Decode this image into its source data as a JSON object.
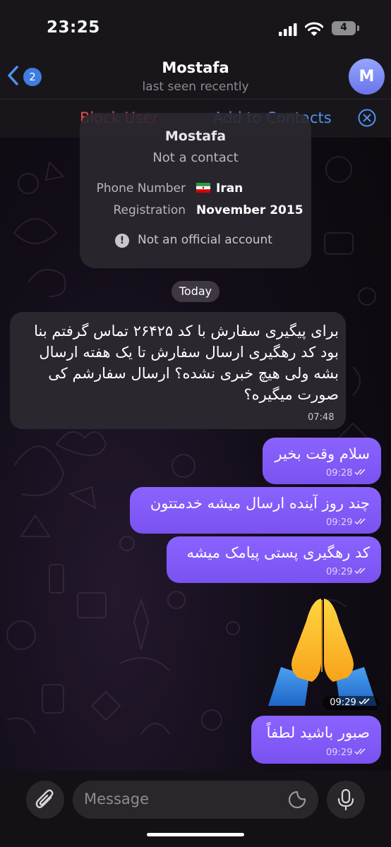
{
  "status_bar": {
    "time": "23:25",
    "battery": "4"
  },
  "header": {
    "back_count": "2",
    "title": "Mostafa",
    "subtitle": "last seen recently",
    "avatar_letter": "M"
  },
  "actions": {
    "block": "Block User",
    "add": "Add to Contacts"
  },
  "contact_card": {
    "name": "Mostafa",
    "status": "Not a contact",
    "phone_label": "Phone Number",
    "phone_value": "Iran",
    "reg_label": "Registration",
    "reg_value": "November 2015",
    "official": "Not an official account"
  },
  "date_divider": "Today",
  "messages": [
    {
      "dir": "in",
      "lines": [
        "برای پیگیری سفارش با کد ۲۶۴۲۵ تماس گرفتم بنا",
        "بود کد رهگیری ارسال سفارش تا یک هفته ارسال",
        "بشه ولی هیچ خبری نشده؟ ارسال سفارشم کی",
        "صورت میگیره؟"
      ],
      "time": "07:48"
    },
    {
      "dir": "out",
      "text": "سلام وقت بخیر",
      "time": "09:28"
    },
    {
      "dir": "out",
      "text": "چند روز آینده ارسال میشه خدمتتون",
      "time": "09:29"
    },
    {
      "dir": "out",
      "text": "کد رهگیری پستی پیامک میشه",
      "time": "09:29"
    },
    {
      "dir": "out",
      "emoji": "folded-hands",
      "time": "09:29"
    },
    {
      "dir": "out",
      "text": "صبور باشید لطفاً",
      "time": "09:29"
    }
  ],
  "input": {
    "placeholder": "Message"
  },
  "colors": {
    "accent": "#4f93ee",
    "danger": "#ea4c4c",
    "outgoing": "#8a63ff",
    "incoming": "#2b272f"
  },
  "icons": [
    "back-chevron-icon",
    "signal-icon",
    "wifi-icon",
    "battery-icon",
    "close-icon",
    "iran-flag-icon",
    "exclamation-icon",
    "double-check-icon",
    "paperclip-icon",
    "sticker-icon",
    "microphone-icon"
  ]
}
